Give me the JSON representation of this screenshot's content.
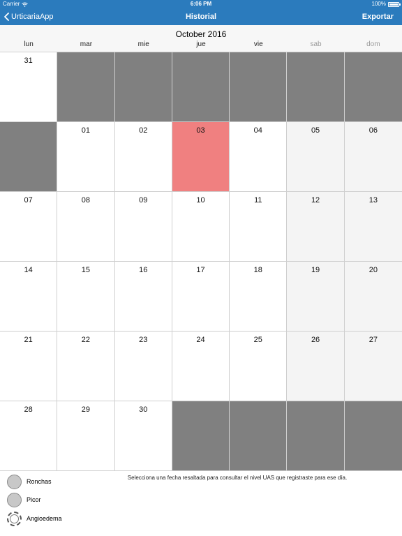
{
  "status_bar": {
    "carrier": "Carrier",
    "time": "6:06 PM",
    "battery": "100%",
    "battery_level": 1.0
  },
  "nav": {
    "back_label": "UrticariaApp",
    "title": "Historial",
    "export_label": "Exportar"
  },
  "calendar": {
    "month_title": "October 2016",
    "weekdays": [
      "lun",
      "mar",
      "mie",
      "jue",
      "vie",
      "sab",
      "dom"
    ],
    "highlight_color": "#f08080",
    "empty_color": "#808080",
    "days": [
      "31",
      "",
      "",
      "",
      "",
      "",
      "",
      "",
      "01",
      "02",
      "03",
      "04",
      "05",
      "06",
      "07",
      "08",
      "09",
      "10",
      "11",
      "12",
      "13",
      "14",
      "15",
      "16",
      "17",
      "18",
      "19",
      "20",
      "21",
      "22",
      "23",
      "24",
      "25",
      "26",
      "27",
      "28",
      "29",
      "30",
      "",
      "",
      "",
      ""
    ],
    "highlighted_day": "03"
  },
  "legend": {
    "items": [
      {
        "label": "Ronchas",
        "icon": "filled-circle-icon"
      },
      {
        "label": "Picor",
        "icon": "filled-circle-icon"
      },
      {
        "label": "Angioedema",
        "icon": "dashed-circle-icon"
      }
    ],
    "hint": "Selecciona una fecha resaltada para consultar el nivel UAS que registraste para ese día."
  }
}
